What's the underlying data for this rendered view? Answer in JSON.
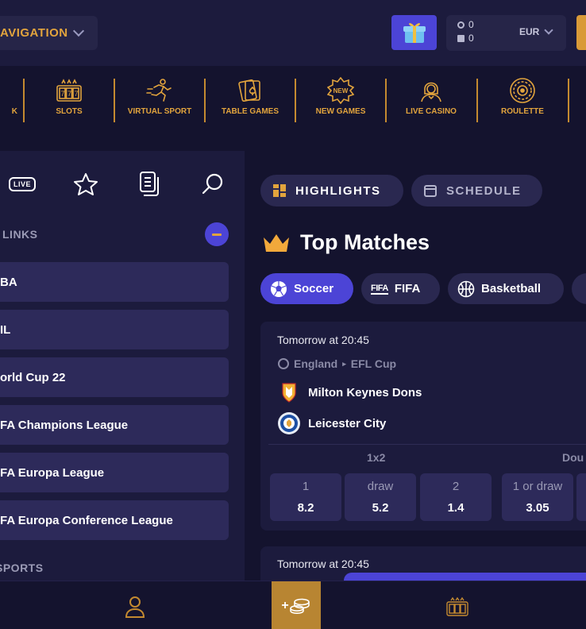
{
  "header": {
    "nav_label": "AVIGATION",
    "balance_money": "0",
    "balance_bonus": "0",
    "currency": "EUR"
  },
  "categories": [
    {
      "label": "K",
      "icon": "sport-icon"
    },
    {
      "label": "SLOTS",
      "icon": "slots-icon"
    },
    {
      "label": "VIRTUAL SPORT",
      "icon": "runner-icon"
    },
    {
      "label": "TABLE GAMES",
      "icon": "cards-icon"
    },
    {
      "label": "NEW GAMES",
      "icon": "new-badge-icon"
    },
    {
      "label": "LIVE CASINO",
      "icon": "dealer-icon"
    },
    {
      "label": "ROULETTE",
      "icon": "roulette-icon"
    }
  ],
  "sidebar": {
    "live_badge": "LIVE",
    "quick_links_title": "K LINKS",
    "quick_links": [
      "BA",
      "IL",
      "orld Cup 22",
      "FA Champions League",
      "FA Europa League",
      "FA Europa Conference League"
    ],
    "sports_title": "SPORTS"
  },
  "main": {
    "tabs": [
      "HIGHLIGHTS",
      "SCHEDULE"
    ],
    "section_title": "Top Matches",
    "sport_pills": [
      "Soccer",
      "FIFA",
      "Basketball"
    ],
    "fifa_logo": "FIFA",
    "match": {
      "time": "Tomorrow at 20:45",
      "country": "England",
      "league": "EFL Cup",
      "team_home": "Milton Keynes Dons",
      "team_away": "Leicester City",
      "market_1": "1x2",
      "market_2": "Dou",
      "odds": [
        {
          "label": "1",
          "value": "8.2"
        },
        {
          "label": "draw",
          "value": "5.2"
        },
        {
          "label": "2",
          "value": "1.4"
        },
        {
          "label": "1 or draw",
          "value": "3.05"
        }
      ]
    },
    "match2_time": "Tomorrow at 20:45"
  },
  "bottom": {
    "center_label": "+"
  },
  "colors": {
    "accent": "#4c44d6",
    "gold": "#e2a43d",
    "bg": "#14132e",
    "panel": "#1c1b3d"
  }
}
